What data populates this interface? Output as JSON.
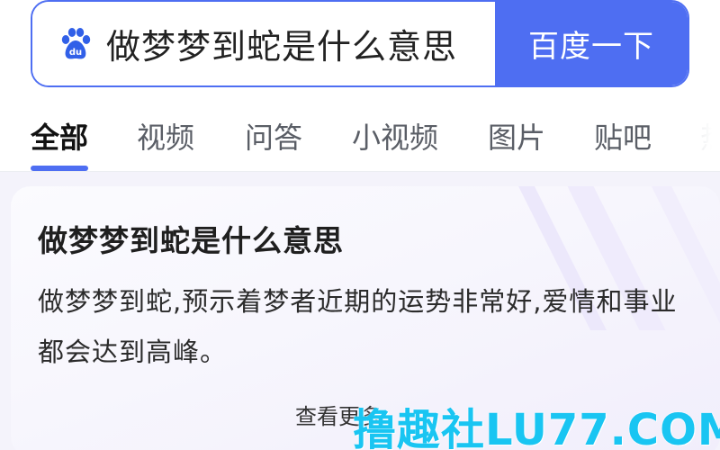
{
  "search": {
    "query": "做梦梦到蛇是什么意思",
    "button_label": "百度一下",
    "logo_text": "du"
  },
  "tabs": [
    {
      "label": "全部",
      "active": true
    },
    {
      "label": "视频",
      "active": false
    },
    {
      "label": "问答",
      "active": false
    },
    {
      "label": "小视频",
      "active": false
    },
    {
      "label": "图片",
      "active": false
    },
    {
      "label": "贴吧",
      "active": false
    },
    {
      "label": "热",
      "active": false
    }
  ],
  "answer": {
    "title": "做梦梦到蛇是什么意思",
    "body": "做梦梦到蛇,预示着梦者近期的运势非常好,爱情和事业都会达到高峰。",
    "more_label": "查看更多"
  },
  "watermark": "撸趣社LU77.COM",
  "colors": {
    "brand_blue": "#4e6ef2",
    "watermark": "#19c5f2",
    "card_bg": "#f4f3fb"
  }
}
